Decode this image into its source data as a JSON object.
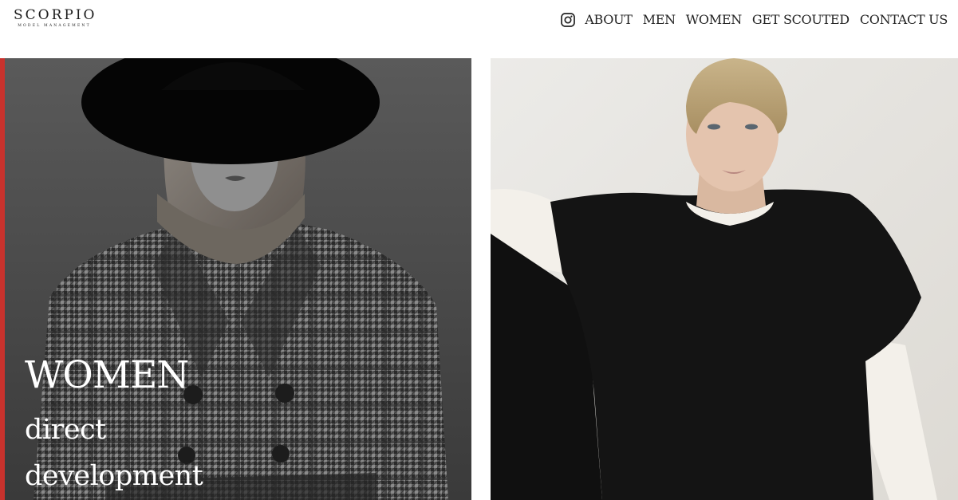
{
  "header": {
    "logo_title": "SCORPIO",
    "logo_subtitle": "MODEL MANAGEMENT",
    "nav": {
      "instagram_icon": "instagram-icon",
      "items": [
        "ABOUT",
        "MEN",
        "WOMEN",
        "GET SCOUTED",
        "CONTACT US"
      ]
    }
  },
  "panels": {
    "women": {
      "title": "WOMEN",
      "subtitle_line1": "direct",
      "subtitle_line2": "development"
    }
  },
  "colors": {
    "accent": "#c8322d",
    "text": "#222222",
    "overlay_text": "#ffffff"
  }
}
